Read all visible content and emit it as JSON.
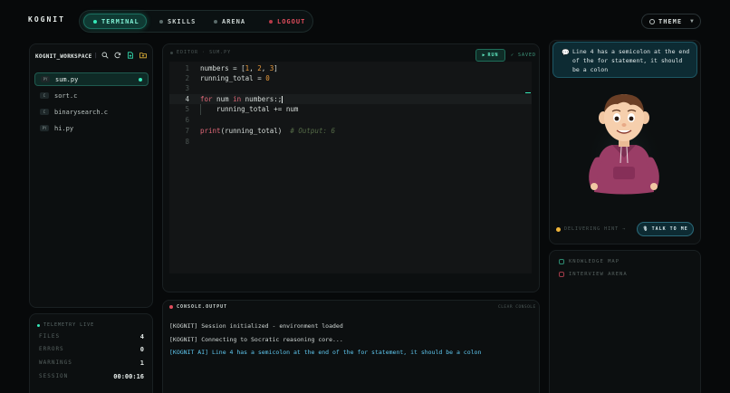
{
  "app": {
    "logo": "KOGNIT"
  },
  "nav": {
    "terminal": "TERMINAL",
    "skills": "SKILLS",
    "arena": "ARENA",
    "logout": "LOGOUT"
  },
  "theme": {
    "label": "THEME",
    "chevron": "▼"
  },
  "workspace": {
    "title": "KOGNIT_WORKSPACE",
    "files": [
      {
        "tag": "PY",
        "name": "sum.py",
        "active": true
      },
      {
        "tag": "C",
        "name": "sort.c"
      },
      {
        "tag": "C",
        "name": "binarysearch.c"
      },
      {
        "tag": "PY",
        "name": "hi.py"
      }
    ]
  },
  "telemetry": {
    "title": "TELEMETRY LIVE",
    "rows": [
      {
        "key": "FILES",
        "value": "4"
      },
      {
        "key": "ERRORS",
        "value": "0"
      },
      {
        "key": "WARNINGS",
        "value": "1"
      },
      {
        "key": "SESSION",
        "value": "00:00:16"
      }
    ]
  },
  "editor": {
    "label": "EDITOR · SUM.PY",
    "run_label": "RUN",
    "saved_label": "✓ SAVED",
    "lines": [
      {
        "no": "1"
      },
      {
        "no": "2"
      },
      {
        "no": "3"
      },
      {
        "no": "4"
      },
      {
        "no": "5"
      },
      {
        "no": "6"
      },
      {
        "no": "7"
      },
      {
        "no": "8"
      }
    ],
    "code": {
      "l1a": "numbers = [",
      "l1n1": "1",
      "l1s1": ", ",
      "l1n2": "2",
      "l1s2": ", ",
      "l1n3": "3",
      "l1b": "]",
      "l2a": "running_total = ",
      "l2n": "0",
      "l4kw1": "for",
      "l4a": " num ",
      "l4kw2": "in",
      "l4b": " numbers:;",
      "l5": "    running_total += num",
      "l7fn": "print",
      "l7a": "(running_total)",
      "l7cm": "  # Output: 6"
    }
  },
  "console": {
    "title": "CONSOLE.OUTPUT",
    "clear_label": "CLEAR CONSOLE",
    "lines": [
      "[KOGNIT] Session initialized - environment loaded",
      "[KOGNIT] Connecting to Socratic reasoning core...",
      "[KOGNIT AI] Line 4 has a semicolon at the end of the for statement, it should be a colon"
    ]
  },
  "assistant": {
    "bubble": "Line 4 has a semicolon at the end of the for statement, it should be a colon",
    "status": "DELIVERING HINT →",
    "talk_label": "TALK TO ME"
  },
  "quick_links": [
    {
      "label": "KNOWLEDGE MAP"
    },
    {
      "label": "INTERVIEW ARENA"
    }
  ],
  "colors": {
    "accent": "#36e8b8",
    "danger": "#e04d5c",
    "ai_text": "#5fc8f0",
    "hint": "#f0b53a"
  }
}
